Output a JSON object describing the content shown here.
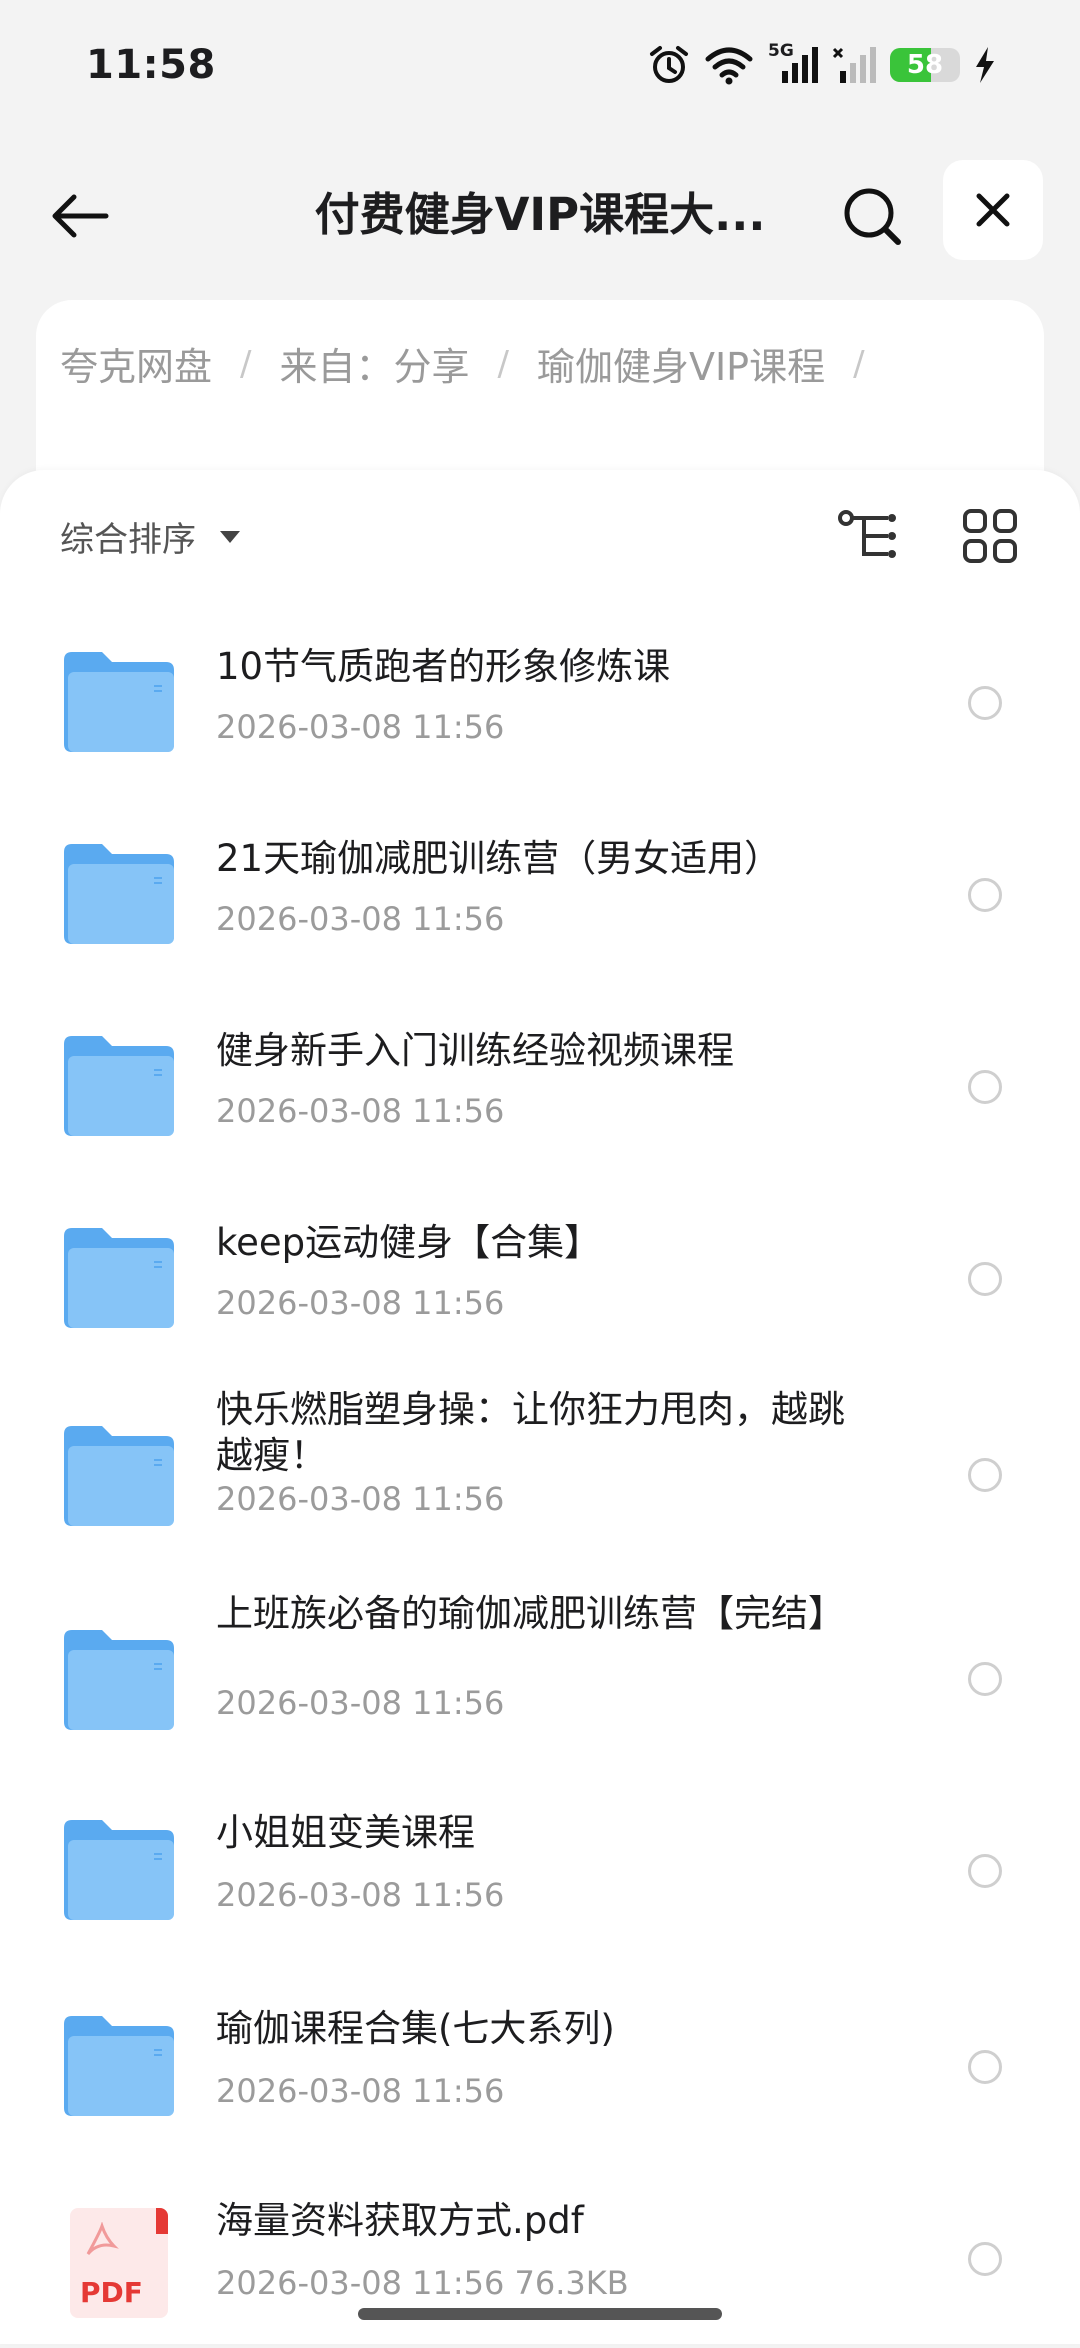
{
  "status_bar": {
    "time": "11:58",
    "network": "5G",
    "battery_level": "58",
    "battery_fraction": 0.58,
    "colors": {
      "battery": "#3ac43a"
    }
  },
  "header": {
    "title": "付费健身VIP课程大..."
  },
  "breadcrumb": [
    "夸克网盘",
    "来自：分享",
    "瑜伽健身VIP课程"
  ],
  "toolbar": {
    "sort_label": "综合排序"
  },
  "files": [
    {
      "name": "10节气质跑者的形象修炼课",
      "meta": "2026-03-08 11:56",
      "type": "folder"
    },
    {
      "name": "21天瑜伽减肥训练营（男女适用）",
      "meta": "2026-03-08 11:56",
      "type": "folder"
    },
    {
      "name": "健身新手入门训练经验视频课程",
      "meta": "2026-03-08 11:56",
      "type": "folder"
    },
    {
      "name": "keep运动健身【合集】",
      "meta": "2026-03-08 11:56",
      "type": "folder"
    },
    {
      "name": "快乐燃脂塑身操：让你狂力甩肉，越跳越瘦！",
      "meta": "2026-03-08 11:56",
      "type": "folder"
    },
    {
      "name": "上班族必备的瑜伽减肥训练营【完结】",
      "meta": "2026-03-08 11:56",
      "type": "folder"
    },
    {
      "name": "小姐姐变美课程",
      "meta": "2026-03-08 11:56",
      "type": "folder"
    },
    {
      "name": "瑜伽课程合集(七大系列)",
      "meta": "2026-03-08 11:56",
      "type": "folder"
    },
    {
      "name": "海量资料获取方式.pdf",
      "meta": "2026-03-08 11:56  76.3KB",
      "type": "pdf",
      "icon_label": "PDF"
    }
  ],
  "icons": {
    "back": "arrow-left-icon",
    "search": "search-icon",
    "close": "close-icon",
    "tree": "tree-structure-icon",
    "grid": "grid-view-icon",
    "folder": "folder-icon",
    "pdf": "pdf-file-icon"
  },
  "colors": {
    "folder": "#66b3f2",
    "pdf": "#e53935"
  }
}
